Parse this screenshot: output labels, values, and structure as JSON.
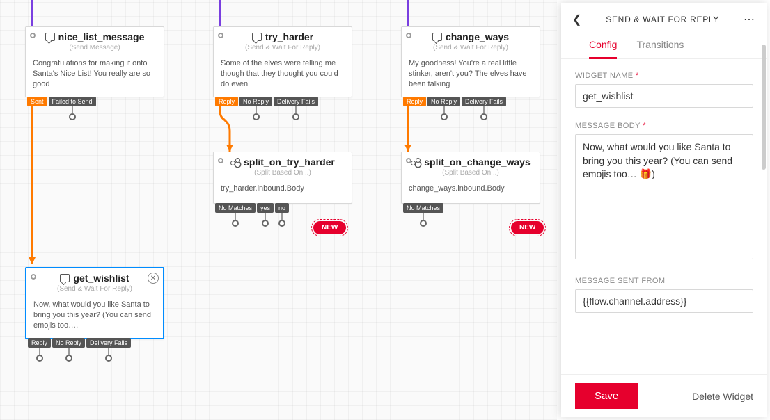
{
  "widgets": {
    "nice_list_message": {
      "title": "nice_list_message",
      "subtitle": "(Send Message)",
      "body": "Congratulations for making it onto Santa's Nice List! You really are so good",
      "transitions": [
        "Sent",
        "Failed to Send"
      ]
    },
    "try_harder": {
      "title": "try_harder",
      "subtitle": "(Send & Wait For Reply)",
      "body": "Some of the elves were telling me though that they thought you could do even",
      "transitions": [
        "Reply",
        "No Reply",
        "Delivery Fails"
      ]
    },
    "change_ways": {
      "title": "change_ways",
      "subtitle": "(Send & Wait For Reply)",
      "body": "My goodness! You're a real little stinker, aren't you? The elves have been talking",
      "transitions": [
        "Reply",
        "No Reply",
        "Delivery Fails"
      ]
    },
    "split_on_try_harder": {
      "title": "split_on_try_harder",
      "subtitle": "(Split Based On...)",
      "body": "try_harder.inbound.Body",
      "transitions": [
        "No Matches",
        "yes",
        "no"
      ]
    },
    "split_on_change_ways": {
      "title": "split_on_change_ways",
      "subtitle": "(Split Based On...)",
      "body": "change_ways.inbound.Body",
      "transitions": [
        "No Matches"
      ]
    },
    "get_wishlist": {
      "title": "get_wishlist",
      "subtitle": "(Send & Wait For Reply)",
      "body": "Now, what would you like Santa to bring you this year? (You can send emojis too….",
      "transitions": [
        "Reply",
        "No Reply",
        "Delivery Fails"
      ]
    }
  },
  "new_pill_label": "NEW",
  "sidebar": {
    "title": "SEND & WAIT FOR REPLY",
    "tabs": {
      "config": "Config",
      "transitions": "Transitions"
    },
    "widget_name_label": "WIDGET NAME",
    "widget_name_value": "get_wishlist",
    "message_body_label": "MESSAGE BODY",
    "message_body_value": "Now, what would you like Santa to bring you this year? (You can send emojis too… 🎁)",
    "message_sent_from_label": "MESSAGE SENT FROM",
    "message_sent_from_value": "{{flow.channel.address}}",
    "save_label": "Save",
    "delete_label": "Delete Widget"
  }
}
